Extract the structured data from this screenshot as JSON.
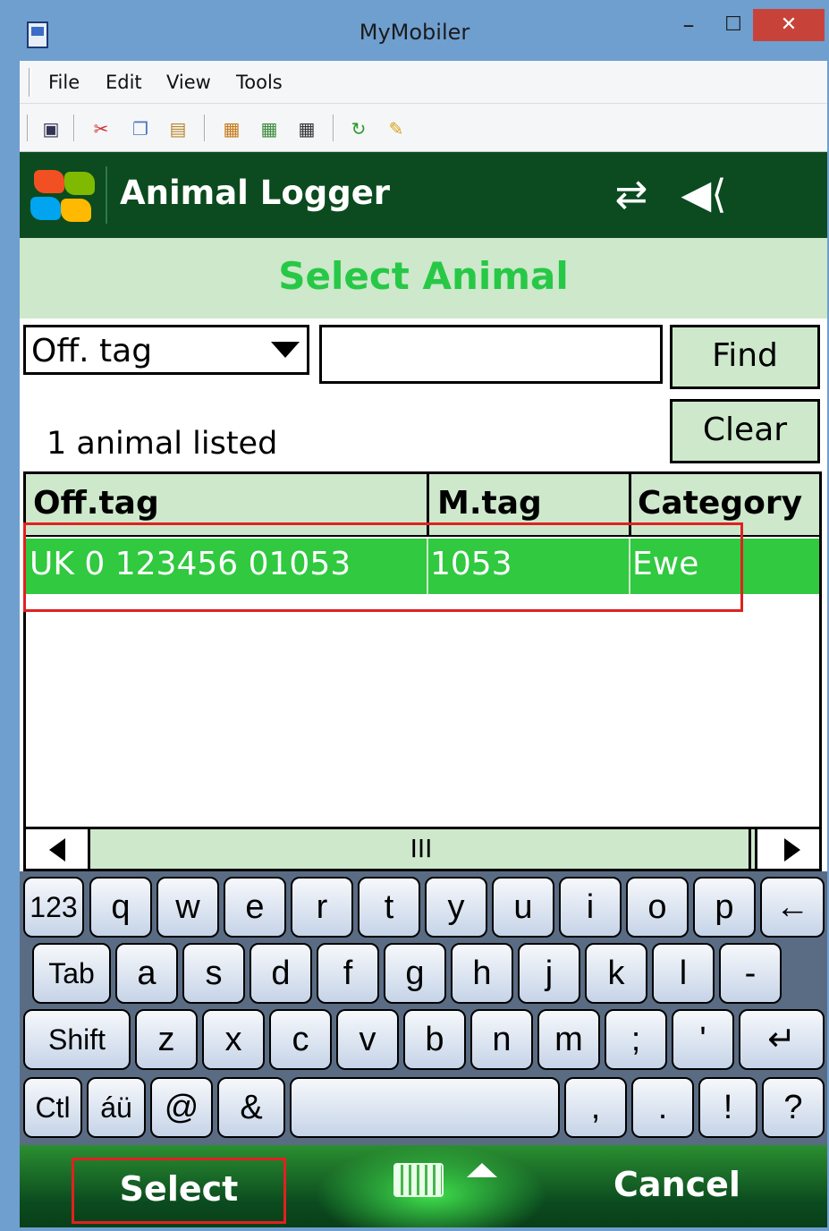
{
  "window": {
    "title": "MyMobiler",
    "minimize": "–",
    "maximize": "☐",
    "close": "✕"
  },
  "menu": {
    "items": [
      "File",
      "Edit",
      "View",
      "Tools"
    ]
  },
  "toolbar": {
    "icons": [
      "monitor-icon",
      "cut-icon",
      "copy-icon",
      "paste-icon",
      "copy-window-icon",
      "paste-window-icon",
      "capture-icon",
      "refresh-icon",
      "clean-icon"
    ]
  },
  "app": {
    "title": "Animal Logger",
    "page_title": "Select Animal"
  },
  "search": {
    "field_selected": "Off. tag",
    "input_value": "",
    "find_label": "Find",
    "clear_label": "Clear",
    "count_text": "1 animal listed"
  },
  "grid": {
    "columns": [
      "Off.tag",
      "M.tag",
      "Category"
    ],
    "rows": [
      {
        "off_tag": "UK 0 123456 01053",
        "m_tag": "1053",
        "category": "Ewe"
      }
    ],
    "scroll_thumb": "III"
  },
  "keyboard": {
    "row1": [
      "123",
      "q",
      "w",
      "e",
      "r",
      "t",
      "y",
      "u",
      "i",
      "o",
      "p",
      "←"
    ],
    "row2": [
      "Tab",
      "a",
      "s",
      "d",
      "f",
      "g",
      "h",
      "j",
      "k",
      "l",
      "-"
    ],
    "row3": [
      "Shift",
      "z",
      "x",
      "c",
      "v",
      "b",
      "n",
      "m",
      ";",
      "'",
      "↵"
    ],
    "row4": [
      "Ctl",
      "áü",
      "@",
      "&",
      "",
      ",",
      ".",
      "!",
      "?"
    ]
  },
  "softkeys": {
    "left": "Select",
    "right": "Cancel"
  },
  "colors": {
    "header_green": "#0b4b1f",
    "title_green": "#27c846",
    "row_selected": "#30c940",
    "band_light": "#cde8cb",
    "highlight_red": "#e02121"
  }
}
